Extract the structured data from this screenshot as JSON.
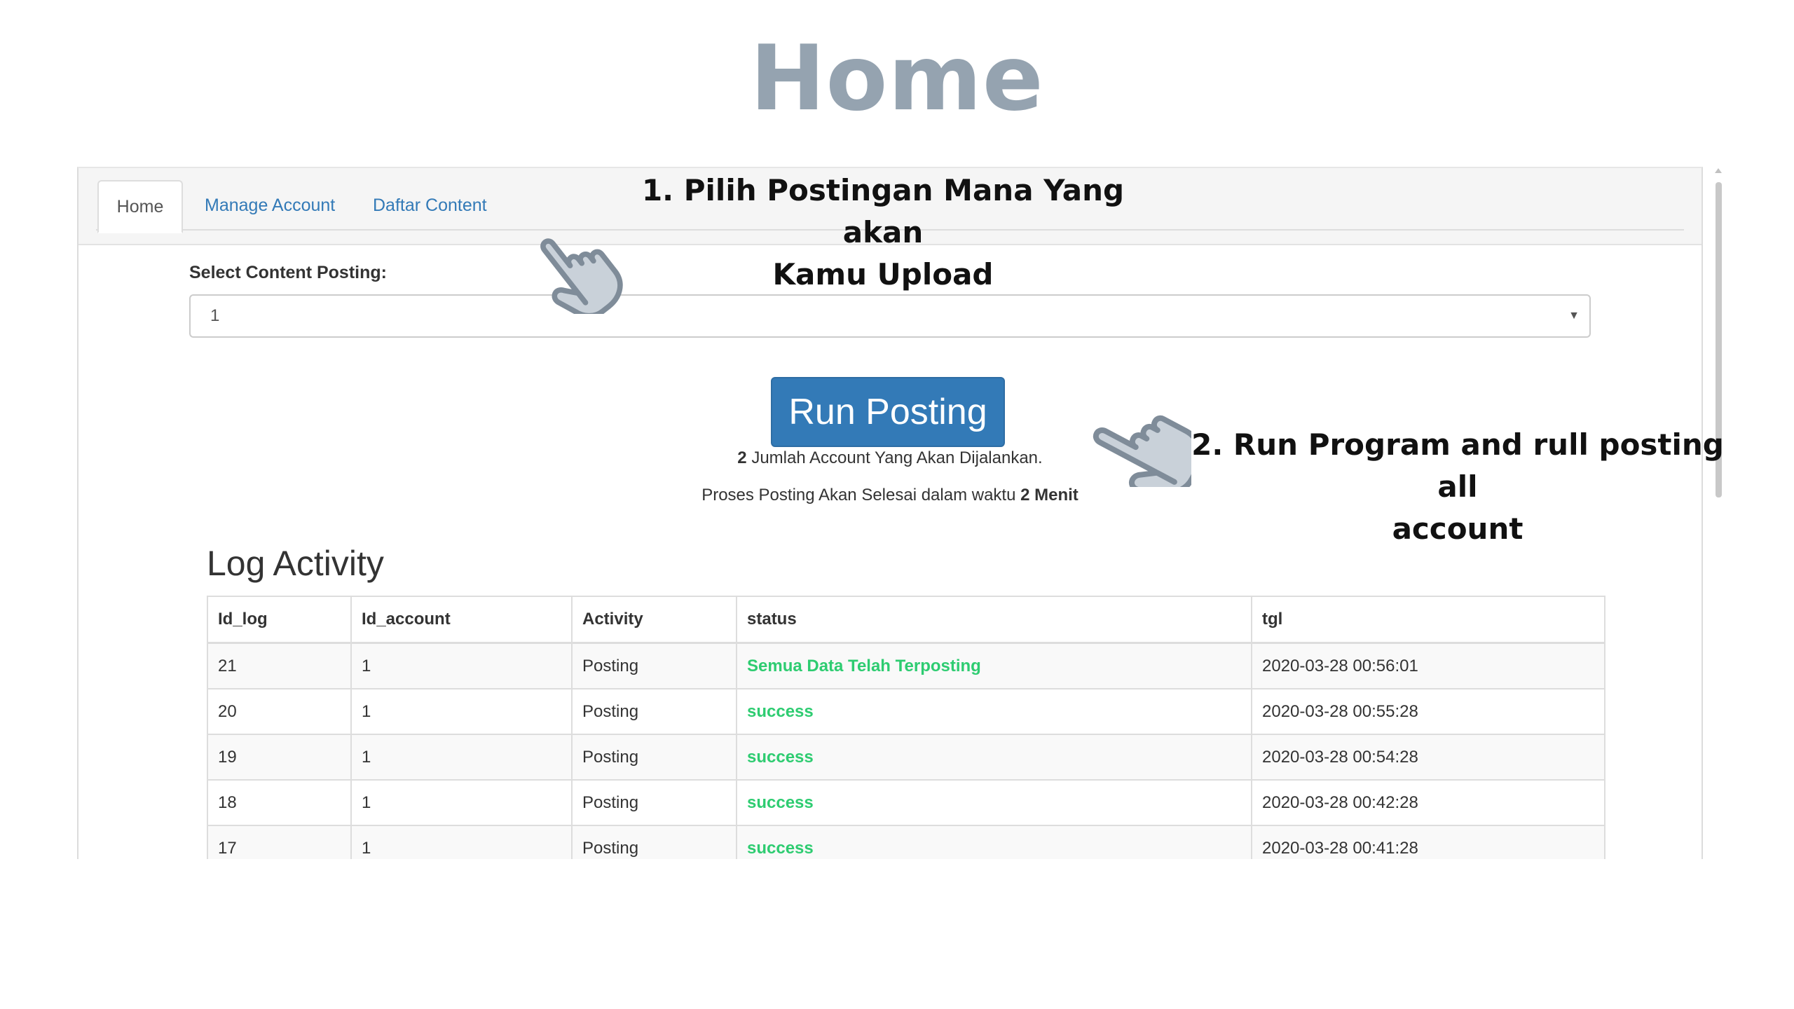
{
  "heading": "Home",
  "tabs": [
    {
      "label": "Home",
      "active": true
    },
    {
      "label": "Manage Account",
      "active": false
    },
    {
      "label": "Daftar Content",
      "active": false
    }
  ],
  "form": {
    "select_label": "Select Content Posting:",
    "selected_value": "1"
  },
  "run_button_label": "Run Posting",
  "info": {
    "account_count": "2",
    "account_text": "Jumlah Account Yang Akan Dijalankan.",
    "time_prefix": "Proses Posting Akan Selesai dalam waktu",
    "time_value": "2 Menit"
  },
  "log": {
    "title": "Log Activity",
    "columns": [
      "Id_log",
      "Id_account",
      "Activity",
      "status",
      "tgl"
    ],
    "rows": [
      [
        "21",
        "1",
        "Posting",
        "Semua Data Telah Terposting",
        "2020-03-28 00:56:01"
      ],
      [
        "20",
        "1",
        "Posting",
        "success",
        "2020-03-28 00:55:28"
      ],
      [
        "19",
        "1",
        "Posting",
        "success",
        "2020-03-28 00:54:28"
      ],
      [
        "18",
        "1",
        "Posting",
        "success",
        "2020-03-28 00:42:28"
      ],
      [
        "17",
        "1",
        "Posting",
        "success",
        "2020-03-28 00:41:28"
      ]
    ]
  },
  "callouts": {
    "step1_line1": "1. Pilih Postingan Mana Yang akan",
    "step1_line2": "Kamu Upload",
    "step2_line1": "2. Run Program and rull posting all",
    "step2_line2": "account"
  },
  "colors": {
    "heading": "#95a3b0",
    "primary": "#337ab7",
    "success": "#2ecc71",
    "hand_fill": "#c9d1d9",
    "hand_outline": "#7f8c99"
  },
  "icons": [
    "pointing-hand-icon",
    "pointing-hand-icon",
    "select-caret-icon"
  ]
}
